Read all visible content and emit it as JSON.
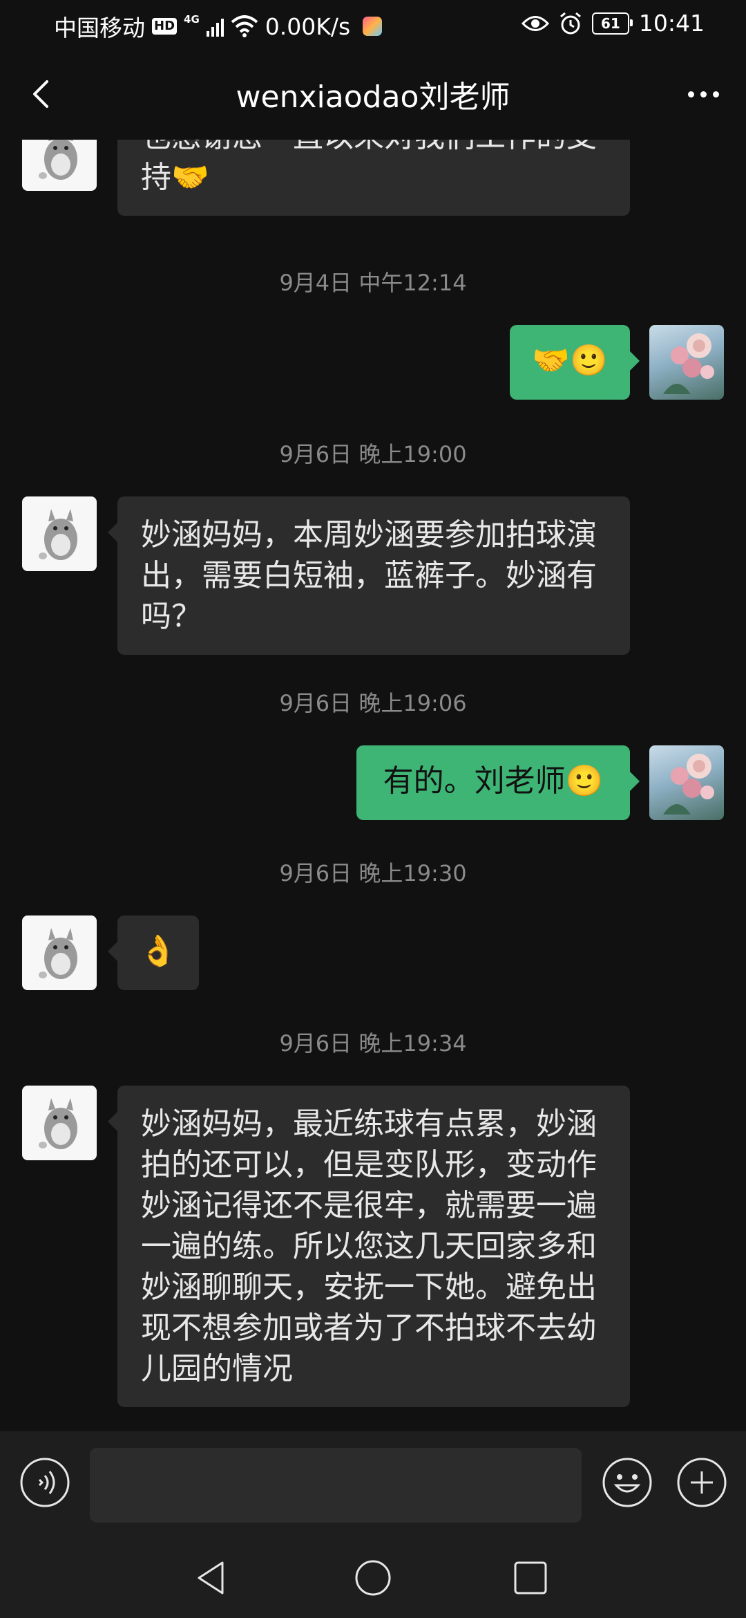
{
  "status_bar": {
    "carrier": "中国移动",
    "hd": "HD",
    "network": "4G",
    "speed": "0.00K/s",
    "battery": "61",
    "time": "10:41"
  },
  "header": {
    "title": "wenxiaodao刘老师"
  },
  "messages": [
    {
      "from": "teacher",
      "text": "也感谢您一直以来对我们工作的支持🤝"
    },
    {
      "type": "time",
      "text": "9月4日 中午12:14"
    },
    {
      "from": "me",
      "text": "🤝🙂"
    },
    {
      "type": "time",
      "text": "9月6日 晚上19:00"
    },
    {
      "from": "teacher",
      "text": "妙涵妈妈，本周妙涵要参加拍球演出，需要白短袖，蓝裤子。妙涵有吗？"
    },
    {
      "type": "time",
      "text": "9月6日 晚上19:06"
    },
    {
      "from": "me",
      "text": "有的。刘老师🙂"
    },
    {
      "type": "time",
      "text": "9月6日 晚上19:30"
    },
    {
      "from": "teacher",
      "text": "👌"
    },
    {
      "type": "time",
      "text": "9月6日 晚上19:34"
    },
    {
      "from": "teacher",
      "text": "妙涵妈妈，最近练球有点累，妙涵拍的还可以，但是变队形，变动作妙涵记得还不是很牢，就需要一遍一遍的练。所以您这几天回家多和妙涵聊聊天，安抚一下她。避免出现不想参加或者为了不拍球不去幼儿园的情况"
    }
  ],
  "input_bar": {
    "value": "",
    "voice_icon": "voice-icon",
    "emoji_icon": "emoji-icon",
    "plus_icon": "plus-icon"
  },
  "colors": {
    "background": "#111111",
    "incoming_bubble": "#2c2c2c",
    "outgoing_bubble": "#3eb575",
    "timestamp": "#8a8a8a"
  }
}
